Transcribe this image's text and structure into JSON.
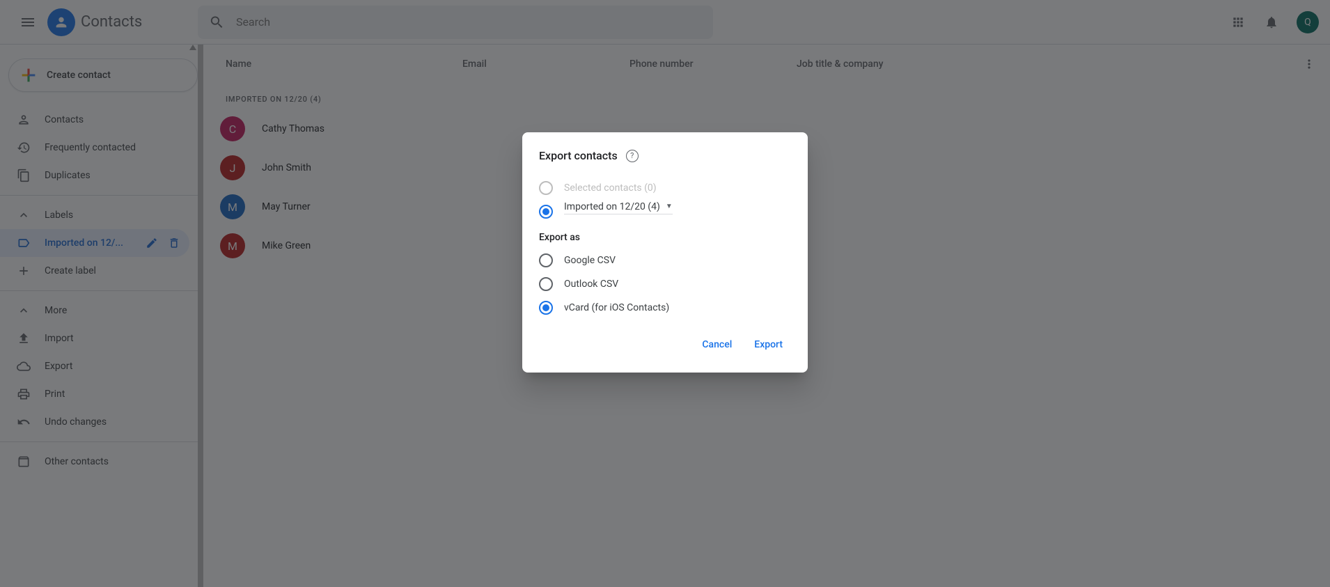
{
  "header": {
    "app_title": "Contacts",
    "search_placeholder": "Search",
    "avatar_initial": "Q"
  },
  "sidebar": {
    "create_label": "Create contact",
    "nav": [
      {
        "label": "Contacts"
      },
      {
        "label": "Frequently contacted"
      },
      {
        "label": "Duplicates"
      }
    ],
    "labels_header": "Labels",
    "labels": [
      {
        "label": "Imported on 12/..."
      }
    ],
    "create_label_label": "Create label",
    "more_label": "More",
    "tools": [
      {
        "label": "Import"
      },
      {
        "label": "Export"
      },
      {
        "label": "Print"
      },
      {
        "label": "Undo changes"
      }
    ],
    "other_label": "Other contacts"
  },
  "table": {
    "col_name": "Name",
    "col_email": "Email",
    "col_phone": "Phone number",
    "col_job": "Job title & company",
    "group_label": "IMPORTED ON 12/20 (4)",
    "rows": [
      {
        "initial": "C",
        "name": "Cathy Thomas",
        "color": "#c2185b"
      },
      {
        "initial": "J",
        "name": "John Smith",
        "color": "#b71c1c"
      },
      {
        "initial": "M",
        "name": "May Turner",
        "color": "#1565c0"
      },
      {
        "initial": "M",
        "name": "Mike Green",
        "color": "#b71c1c"
      }
    ]
  },
  "dialog": {
    "title": "Export contacts",
    "scope": {
      "selected_label": "Selected contacts (0)",
      "imported_label": "Imported on 12/20 (4)"
    },
    "export_as_label": "Export as",
    "formats": [
      {
        "label": "Google CSV"
      },
      {
        "label": "Outlook CSV"
      },
      {
        "label": "vCard (for iOS Contacts)"
      }
    ],
    "cancel": "Cancel",
    "export": "Export"
  }
}
